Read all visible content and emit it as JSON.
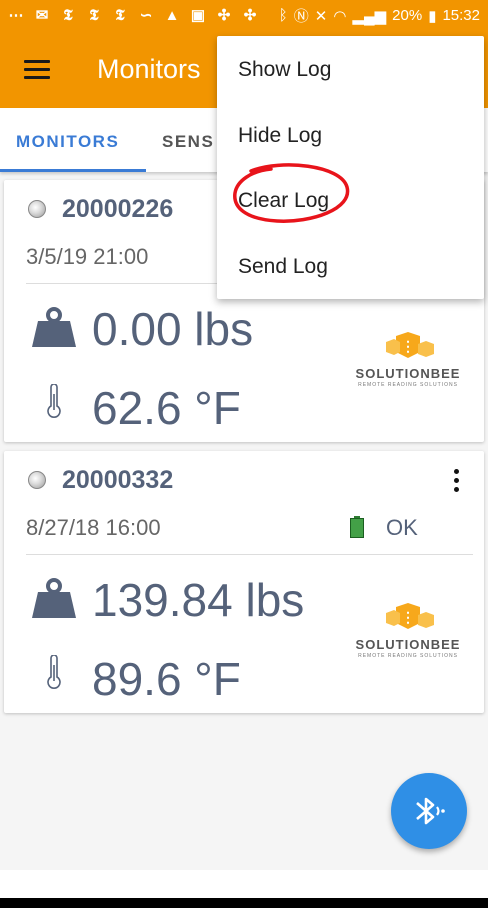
{
  "status_bar": {
    "battery_percent": "20%",
    "time": "15:32",
    "icons": [
      "message-icon",
      "news-icon",
      "news-icon",
      "news-icon",
      "signature-icon",
      "warning-icon",
      "image-icon",
      "pinwheel-icon",
      "pinwheel-icon",
      "bluetooth-icon",
      "nfc-icon",
      "mute-icon",
      "wifi-icon",
      "signal-icon",
      "battery-icon"
    ]
  },
  "app_bar": {
    "title": "Monitors"
  },
  "tabs": [
    {
      "label": "MONITORS",
      "selected": true
    },
    {
      "label": "SENS",
      "selected": false
    }
  ],
  "menu": {
    "items": [
      "Show Log",
      "Hide Log",
      "Clear Log",
      "Send Log"
    ],
    "annotated_item": "Clear Log",
    "annotation_color": "#e8141b"
  },
  "cards": [
    {
      "serial": "20000226",
      "timestamp": "3/5/19 21:00",
      "battery_status": "",
      "weight": "0.00 lbs",
      "temperature": "62.6 °F",
      "logo": "SOLUTIONBEE",
      "logo_tagline": "REMOTE READING SOLUTIONS"
    },
    {
      "serial": "20000332",
      "timestamp": "8/27/18 16:00",
      "battery_status": "OK",
      "weight": "139.84 lbs",
      "temperature": "89.6 °F",
      "logo": "SOLUTIONBEE",
      "logo_tagline": "REMOTE READING SOLUTIONS"
    }
  ],
  "colors": {
    "primary": "#f29500",
    "accent": "#3a7bd5",
    "fab": "#2f8fe6",
    "value_text": "#55627a",
    "battery_ok": "#43a047"
  },
  "fab": {
    "icon": "bluetooth-audio-icon"
  }
}
